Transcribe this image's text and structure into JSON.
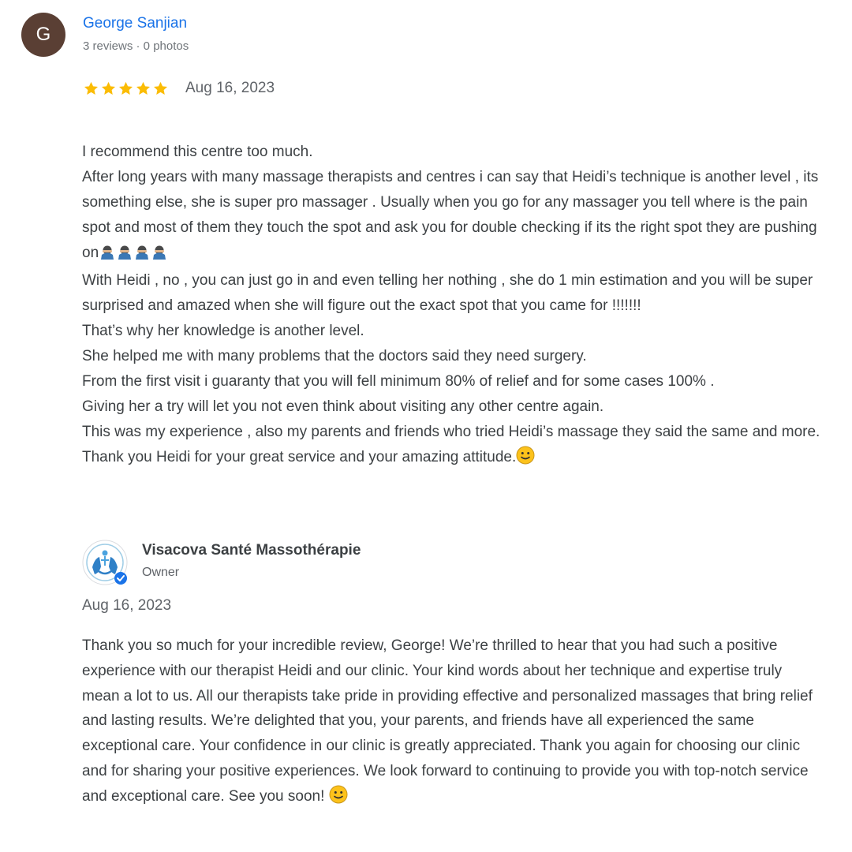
{
  "review": {
    "avatar_letter": "G",
    "avatar_color": "#5a3f34",
    "reviewer_name": "George Sanjian",
    "reviewer_meta": "3 reviews · 0 photos",
    "rating": 5,
    "max_rating": 5,
    "star_color": "#fbbc04",
    "date": "Aug 16, 2023",
    "text_lines": [
      "I recommend this centre too much.",
      "After long years with many massage therapists and centres i can say that Heidi’s technique is another level , its something else, she is super pro massager . Usually when you go for any massager you tell where is the pain spot and most of them they touch the spot and ask you for double checking if its the right spot they are pushing on",
      "With Heidi , no , you can just go in and even telling her nothing , she do 1 min estimation and you will be super surprised and amazed when she will figure out the exact spot that you came for !!!!!!!",
      "That’s why her knowledge is another level.",
      "She helped me with many problems that the doctors said they need surgery.",
      "From the first visit i guaranty that you will fell minimum 80% of relief and for some cases 100% .",
      "Giving her a try will let you not even think about visiting any other centre again.",
      "This was my experience , also my parents and friends who tried Heidi’s massage they said the same and more.",
      "Thank you Heidi for your great service and your amazing attitude."
    ],
    "emoji_after_line_2": "person-facepalming-emoji x4",
    "emoji_after_last_line": "slightly-smiling-face-emoji"
  },
  "owner_response": {
    "logo_icon": "visacova-hands-logo",
    "verified_badge_color": "#1a73e8",
    "name": "Visacova Santé Massothérapie",
    "role": "Owner",
    "date": "Aug 16, 2023",
    "text": "Thank you so much for your incredible review, George! We’re thrilled to hear that you had such a positive experience with our therapist Heidi and our clinic. Your kind words about her technique and expertise truly mean a lot to us. All our therapists take pride in providing effective and personalized massages that bring relief and lasting results. We’re delighted that you, your parents, and friends have all experienced the same exceptional care. Your confidence in our clinic is greatly appreciated. Thank you again for choosing our clinic and for sharing your positive experiences. We look forward to continuing to provide you with top-notch service and exceptional care. See you soon!",
    "emoji_after_text": "slightly-smiling-face-emoji"
  },
  "icons": {
    "more_button": "more-options-icon",
    "star": "star-icon"
  }
}
